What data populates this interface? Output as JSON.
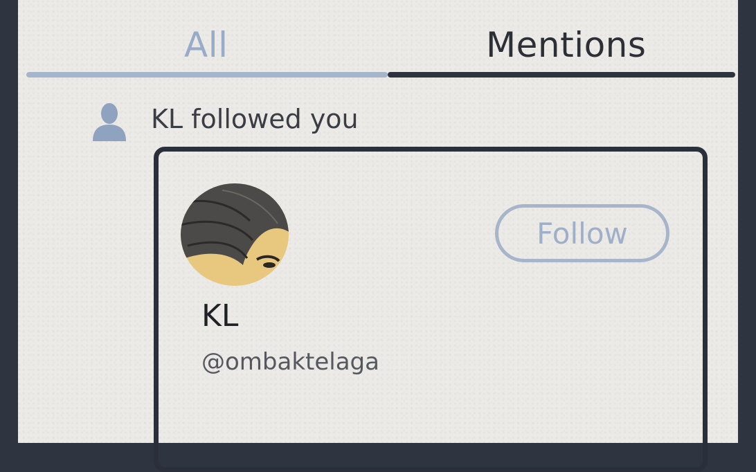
{
  "tabs": {
    "all": "All",
    "mentions": "Mentions"
  },
  "notification": {
    "icon": "person-icon",
    "text": "KL followed you"
  },
  "card": {
    "name": "KL",
    "handle": "@ombaktelaga",
    "follow_label": "Follow"
  },
  "colors": {
    "active_tab": "#98abc8",
    "inactive_tab": "#2c2f36",
    "follow_button": "#a7b5cb",
    "frame": "#2f3441"
  }
}
